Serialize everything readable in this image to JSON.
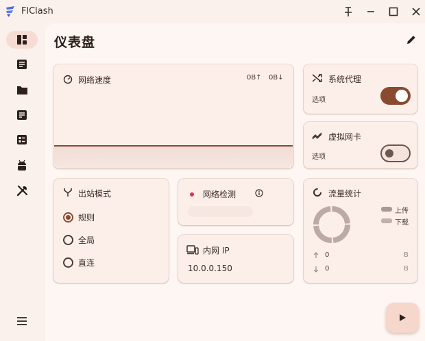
{
  "app": {
    "title": "FlClash"
  },
  "colors": {
    "accent": "#8a4a30",
    "background": "#fbf1ec",
    "card": "#fcefe9",
    "alert": "#e0324a"
  },
  "sidebar": {
    "items": [
      {
        "icon": "dashboard-icon",
        "active": true
      },
      {
        "icon": "list-icon"
      },
      {
        "icon": "folder-icon"
      },
      {
        "icon": "document-icon"
      },
      {
        "icon": "checklist-icon"
      },
      {
        "icon": "android-icon"
      },
      {
        "icon": "tools-icon"
      }
    ],
    "menu_icon": "menu-icon"
  },
  "page": {
    "title": "仪表盘"
  },
  "network_speed": {
    "title": "网络速度",
    "upload": "0B↑",
    "download": "0B↓"
  },
  "system_proxy": {
    "title": "系统代理",
    "subtitle": "选项",
    "enabled": true
  },
  "tun": {
    "title": "虚拟网卡",
    "subtitle": "选项",
    "enabled": false
  },
  "outbound_mode": {
    "title": "出站模式",
    "options": [
      {
        "label": "规则",
        "selected": true
      },
      {
        "label": "全局",
        "selected": false
      },
      {
        "label": "直连",
        "selected": false
      }
    ]
  },
  "network_check": {
    "title": "网络检测"
  },
  "intranet_ip": {
    "title": "内网 IP",
    "value": "10.0.0.150"
  },
  "traffic": {
    "title": "流量统计",
    "legend_upload": "上传",
    "legend_download": "下载",
    "upload_value": "0",
    "upload_unit": "B",
    "download_value": "0",
    "download_unit": "B"
  }
}
